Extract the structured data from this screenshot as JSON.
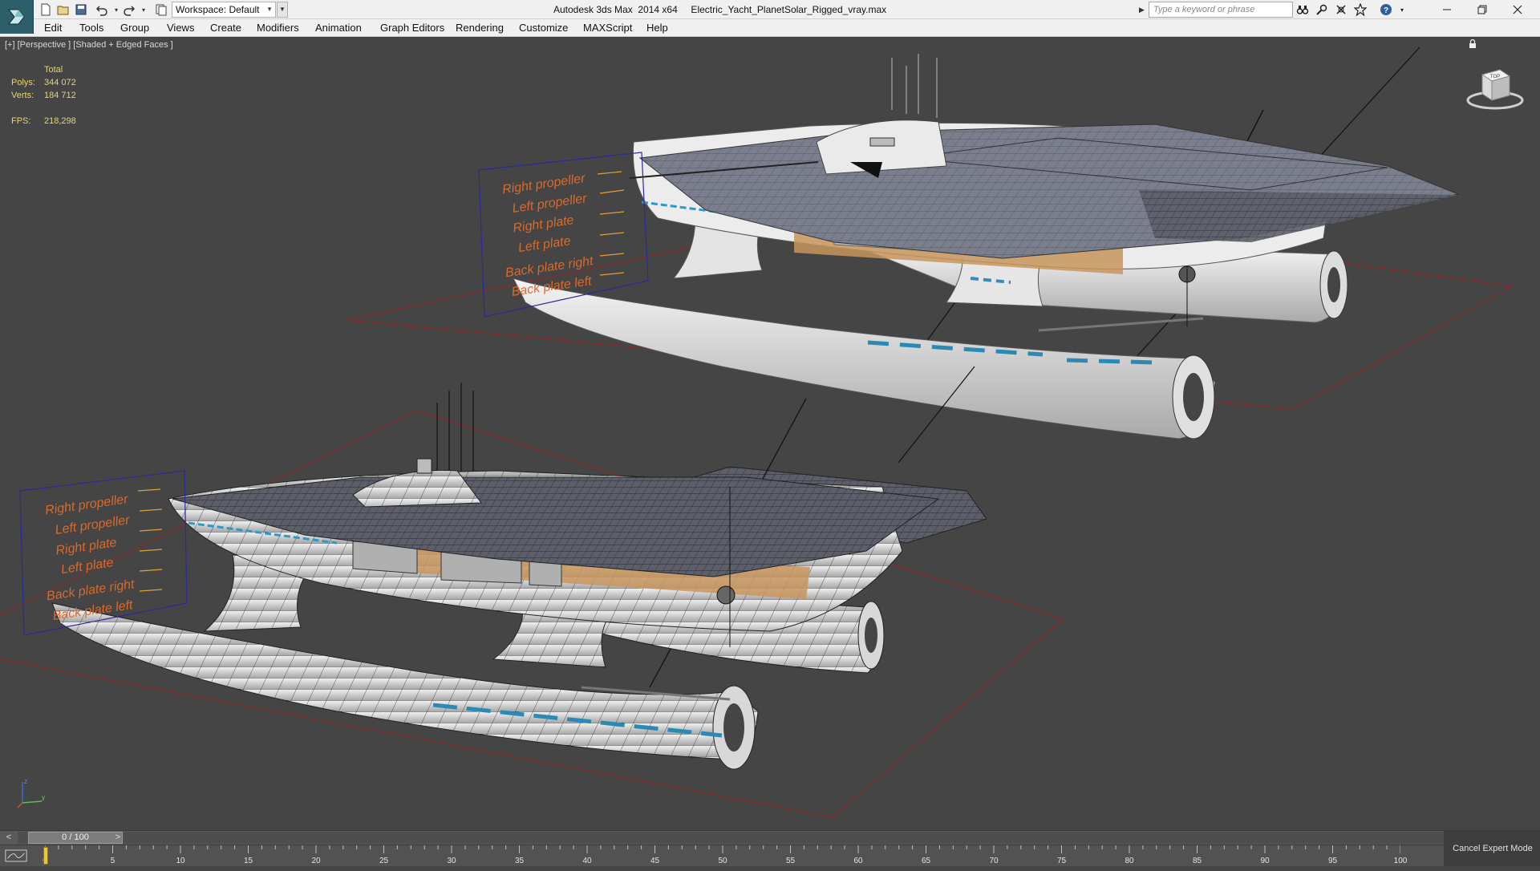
{
  "titlebar": {
    "app_title": "Autodesk 3ds Max  2014 x64     Electric_Yacht_PlanetSolar_Rigged_vray.max",
    "workspace_label": "Workspace: Default",
    "search_placeholder": "Type a keyword or phrase",
    "quick_access_icons": [
      "new-file-icon",
      "open-file-icon",
      "save-icon",
      "undo-icon",
      "redo-icon",
      "project-folder-icon"
    ],
    "help_tools": [
      "binoculars-icon",
      "key-search-icon",
      "exchange-icon",
      "favorites-star-icon",
      "help-icon"
    ],
    "window_controls": [
      "minimize-icon",
      "restore-icon",
      "close-icon"
    ]
  },
  "menubar": {
    "items": [
      "Edit",
      "Tools",
      "Group",
      "Views",
      "Create",
      "Modifiers",
      "Animation",
      "Graph Editors",
      "Rendering",
      "Customize",
      "MAXScript",
      "Help"
    ]
  },
  "viewport": {
    "label": "[+] [Perspective ] [Shaded + Edged Faces ]",
    "stats": {
      "header": "Total",
      "polys_label": "Polys:",
      "polys_value": "344 072",
      "verts_label": "Verts:",
      "verts_value": "184 712",
      "fps_label": "FPS:",
      "fps_value": "218,298"
    },
    "rig_labels_top": [
      "Right propeller",
      "Left propeller",
      "Right plate",
      "Left plate",
      "Back plate right",
      "Back plate left"
    ],
    "rig_labels_bottom": [
      "Right propeller",
      "Left propeller",
      "Right plate",
      "Left plate",
      "Back plate right",
      "Back plate left"
    ],
    "viewcube_label": "TOP",
    "colors": {
      "background": "#454545",
      "stats_text": "#e6d670",
      "rig_text": "#d86a2c",
      "grid_lines": "#8a2a2a",
      "rig_frame": "#2a2a9a"
    }
  },
  "timeline": {
    "frame_display": "0 / 100",
    "prev_label": "<",
    "next_label": ">",
    "current_frame": 0,
    "ticks": [
      "0",
      "5",
      "10",
      "15",
      "20",
      "25",
      "30",
      "35",
      "40",
      "45",
      "50",
      "55",
      "60",
      "65",
      "70",
      "75",
      "80",
      "85",
      "90",
      "95",
      "100"
    ]
  },
  "status": {
    "cancel_expert_mode": "Cancel Expert Mode"
  }
}
